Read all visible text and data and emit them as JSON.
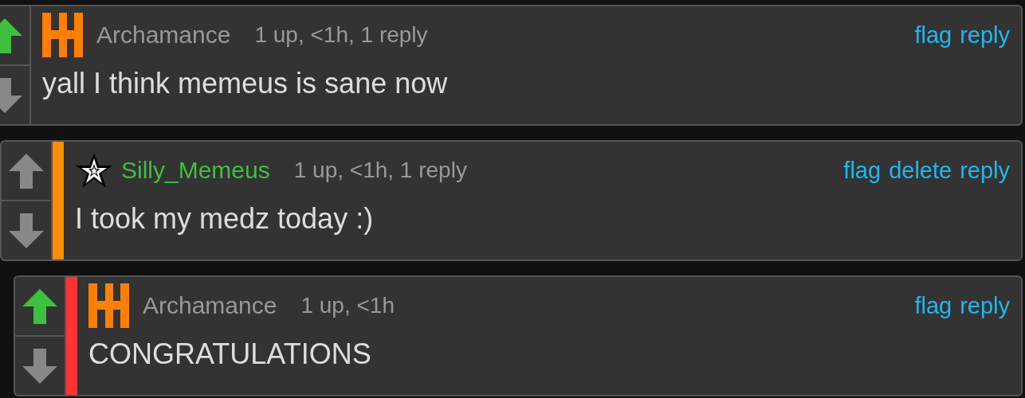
{
  "thread": [
    {
      "avatar": {
        "kind": "hh"
      },
      "username": "Archamance",
      "username_highlighted": false,
      "meta": "1 up, <1h, 1 reply",
      "actions": [
        "flag",
        "reply"
      ],
      "body": "yall I think memeus is sane now",
      "upvoted": true,
      "downvoted": false,
      "children": [
        {
          "avatar": {
            "kind": "star"
          },
          "username": "Silly_Memeus",
          "username_highlighted": true,
          "meta": "1 up, <1h, 1 reply",
          "actions": [
            "flag",
            "delete",
            "reply"
          ],
          "body": "I took my medz today :)",
          "upvoted": false,
          "downvoted": false,
          "color": "#ff8c00",
          "children": [
            {
              "avatar": {
                "kind": "hh"
              },
              "username": "Archamance",
              "username_highlighted": false,
              "meta": "1 up, <1h",
              "actions": [
                "flag",
                "reply"
              ],
              "body": "CONGRATULATIONS",
              "upvoted": true,
              "downvoted": false,
              "color": "#ff3333"
            }
          ]
        }
      ]
    }
  ]
}
